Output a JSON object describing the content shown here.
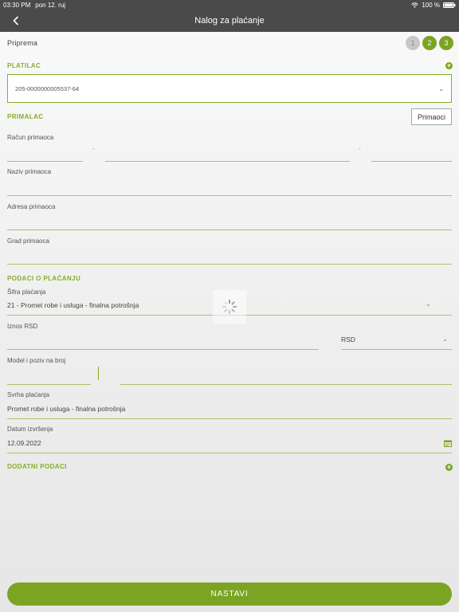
{
  "status_bar": {
    "time": "03:30 PM",
    "date": "pon 12. ruj",
    "battery": "100 %"
  },
  "nav": {
    "title": "Nalog za plaćanje"
  },
  "steps": {
    "label": "Priprema",
    "items": [
      "1",
      "2",
      "3"
    ]
  },
  "platilac": {
    "title": "PLATILAC",
    "account": "205-0000000005537-64"
  },
  "primalac": {
    "title": "PRIMALAC",
    "button": "Primaoci",
    "account_label": "Račun primaoca",
    "dash": "-",
    "name_label": "Naziv primaoca",
    "address_label": "Adresa primaoca",
    "city_label": "Grad primaoca"
  },
  "payment": {
    "title": "PODACI O PLAĆANJU",
    "code_label": "Šifra plaćanja",
    "code_value": "21 - Promet robe i usluga - finalna potrošnja",
    "amount_label": "Iznos RSD",
    "currency": "RSD",
    "model_label": "Model i poziv na broj",
    "purpose_label": "Svrha plaćanja",
    "purpose_value": "Promet robe i usluga - finalna potrošnja",
    "date_label": "Datum izvršenja",
    "date_value": "12.09.2022"
  },
  "extra": {
    "title": "DODATNI PODACI"
  },
  "footer": {
    "continue": "NASTAVI"
  },
  "colors": {
    "accent": "#7ca423",
    "header": "#4a4a4a"
  }
}
